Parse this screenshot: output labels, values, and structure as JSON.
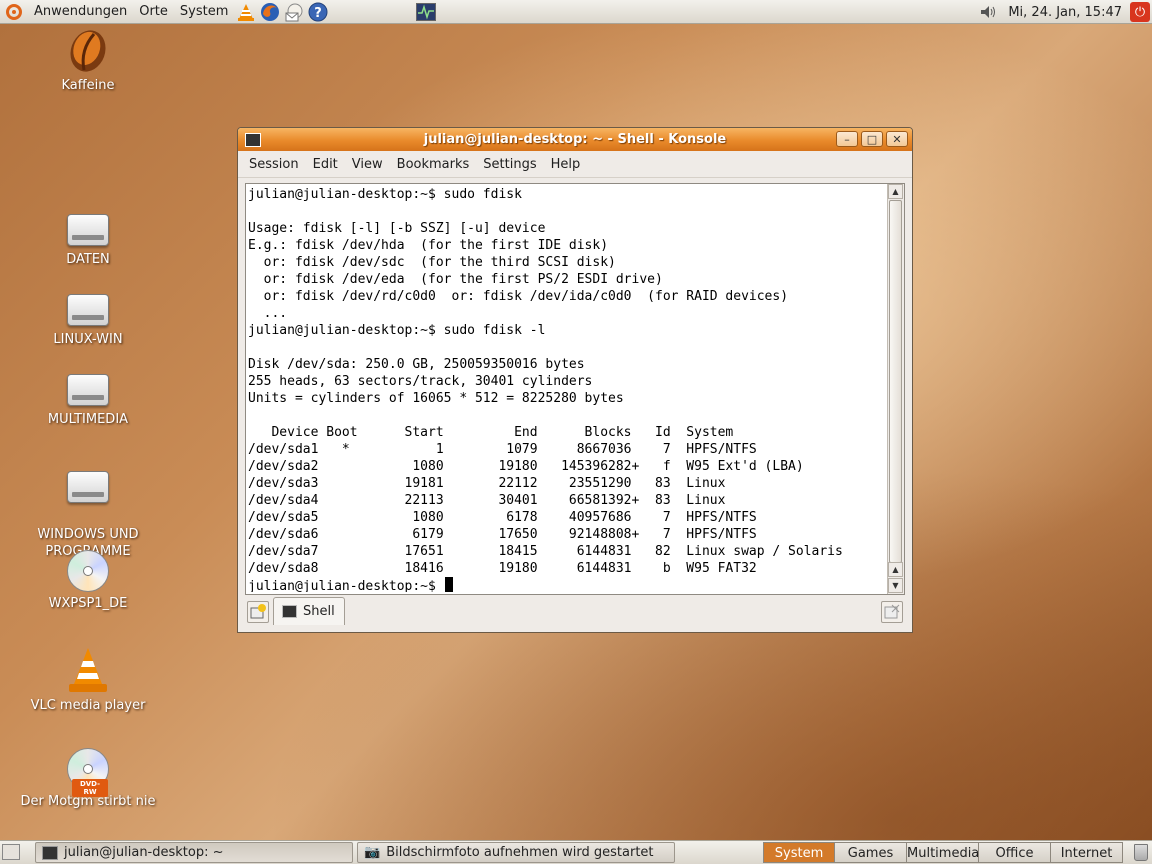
{
  "top_panel": {
    "menus": [
      "Anwendungen",
      "Orte",
      "System"
    ],
    "clock": "Mi, 24. Jan, 15:47"
  },
  "desktop_icons": [
    {
      "label": "Kaffeine",
      "icon": "kaffeine-icon"
    },
    {
      "label": "DATEN",
      "icon": "drive-icon"
    },
    {
      "label": "LINUX-WIN",
      "icon": "drive-icon"
    },
    {
      "label": "MULTIMEDIA",
      "icon": "drive-icon"
    },
    {
      "label": "WINDOWS UND\nPROGRAMME",
      "icon": "drive-icon"
    },
    {
      "label": "WXPSP1_DE",
      "icon": "cd-icon"
    },
    {
      "label": "VLC media player",
      "icon": "vlc-icon"
    },
    {
      "label": "Der Motgm stirbt nie",
      "icon": "dvd-icon",
      "badge": "DVD-RW"
    }
  ],
  "window": {
    "title": "julian@julian-desktop: ~ - Shell - Konsole",
    "menu": [
      "Session",
      "Edit",
      "View",
      "Bookmarks",
      "Settings",
      "Help"
    ],
    "terminal_lines": [
      "julian@julian-desktop:~$ sudo fdisk",
      "",
      "Usage: fdisk [-l] [-b SSZ] [-u] device",
      "E.g.: fdisk /dev/hda  (for the first IDE disk)",
      "  or: fdisk /dev/sdc  (for the third SCSI disk)",
      "  or: fdisk /dev/eda  (for the first PS/2 ESDI drive)",
      "  or: fdisk /dev/rd/c0d0  or: fdisk /dev/ida/c0d0  (for RAID devices)",
      "  ...",
      "julian@julian-desktop:~$ sudo fdisk -l",
      "",
      "Disk /dev/sda: 250.0 GB, 250059350016 bytes",
      "255 heads, 63 sectors/track, 30401 cylinders",
      "Units = cylinders of 16065 * 512 = 8225280 bytes",
      "",
      "   Device Boot      Start         End      Blocks   Id  System",
      "/dev/sda1   *           1        1079     8667036    7  HPFS/NTFS",
      "/dev/sda2            1080       19180   145396282+   f  W95 Ext'd (LBA)",
      "/dev/sda3           19181       22112    23551290   83  Linux",
      "/dev/sda4           22113       30401    66581392+  83  Linux",
      "/dev/sda5            1080        6178    40957686    7  HPFS/NTFS",
      "/dev/sda6            6179       17650    92148808+   7  HPFS/NTFS",
      "/dev/sda7           17651       18415     6144831   82  Linux swap / Solaris",
      "/dev/sda8           18416       19180     6144831    b  W95 FAT32"
    ],
    "prompt": "julian@julian-desktop:~$ ",
    "tab_label": "Shell"
  },
  "bottom_panel": {
    "tasks": [
      {
        "label": "julian@julian-desktop: ~"
      },
      {
        "label": "Bildschirmfoto aufnehmen wird gestartet"
      }
    ],
    "workspaces": [
      "System",
      "Games",
      "Multimedia",
      "Office",
      "Internet"
    ],
    "active_workspace": "System"
  },
  "colors": {
    "accent": "#e98a2b",
    "workspace_active": "#d37a2a",
    "desktop": "#c98c56"
  }
}
